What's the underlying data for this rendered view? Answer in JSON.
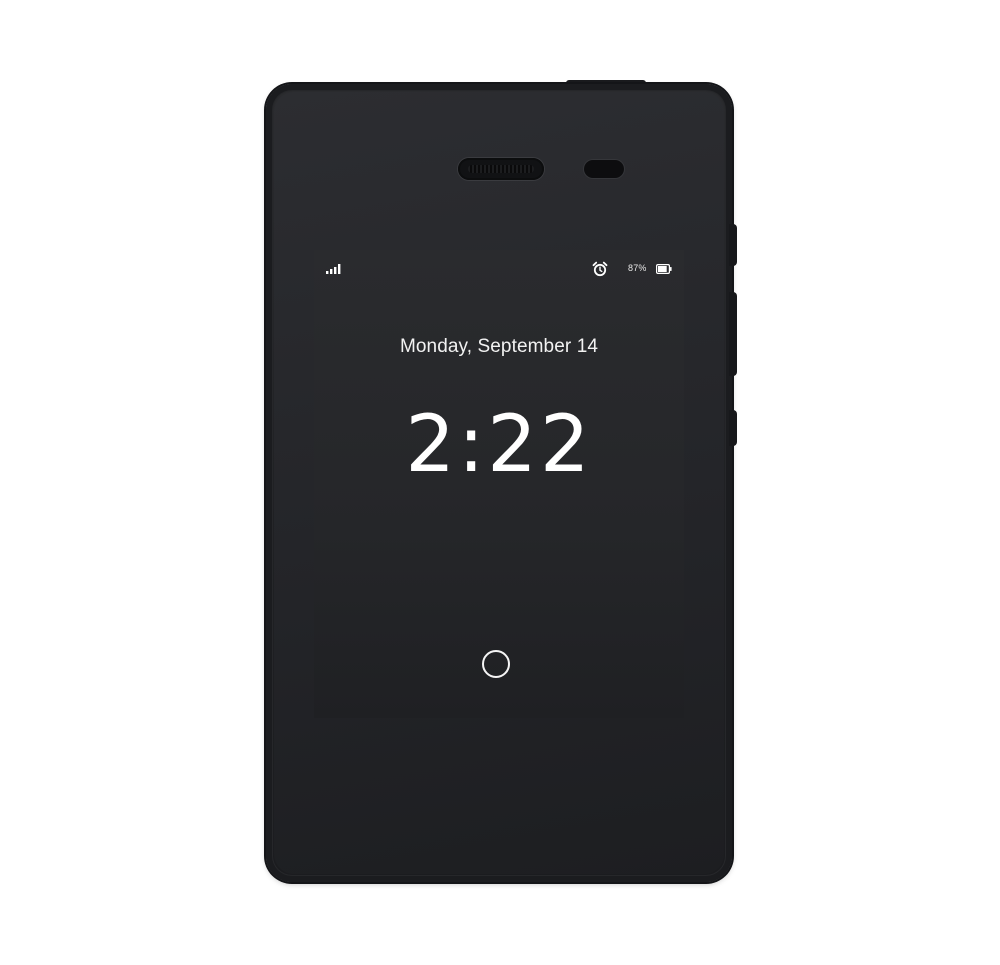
{
  "status_bar": {
    "signal_icon": "signal-bars-icon",
    "alarm_icon": "alarm-clock-icon",
    "battery_percent": "87%",
    "battery_icon": "battery-icon",
    "battery_level": 0.87
  },
  "lock_screen": {
    "date": "Monday, September 14",
    "time": "2:22",
    "home_icon": "circle-home-icon"
  },
  "colors": {
    "device_body": "#222326",
    "screen_bg": "#262729",
    "text": "#ffffff"
  }
}
